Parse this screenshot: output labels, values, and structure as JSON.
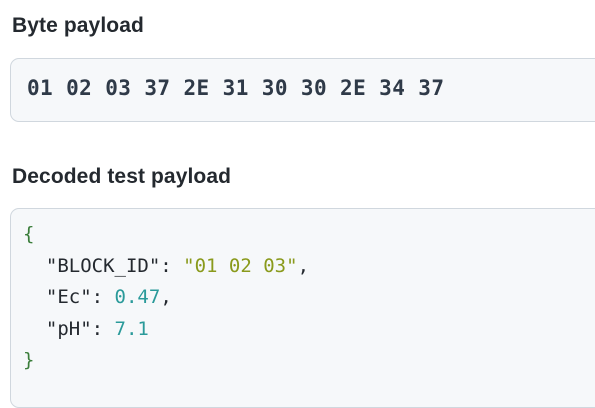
{
  "byte_payload": {
    "label": "Byte payload",
    "value": "01 02 03 37 2E 31 30 30 2E 34 37"
  },
  "decoded": {
    "label": "Decoded test payload",
    "open_brace": "{",
    "close_brace": "}",
    "fields": [
      {
        "key": "\"BLOCK_ID\"",
        "value": "\"01 02 03\"",
        "type": "string",
        "trailing": ","
      },
      {
        "key": "\"Ec\"",
        "value": "0.47",
        "type": "number",
        "trailing": ","
      },
      {
        "key": "\"pH\"",
        "value": "7.1",
        "type": "number",
        "trailing": ""
      }
    ]
  },
  "colors": {
    "string_value": "#8a9a1c",
    "number_value": "#2a9a9a",
    "brace": "#3a7d3a"
  }
}
